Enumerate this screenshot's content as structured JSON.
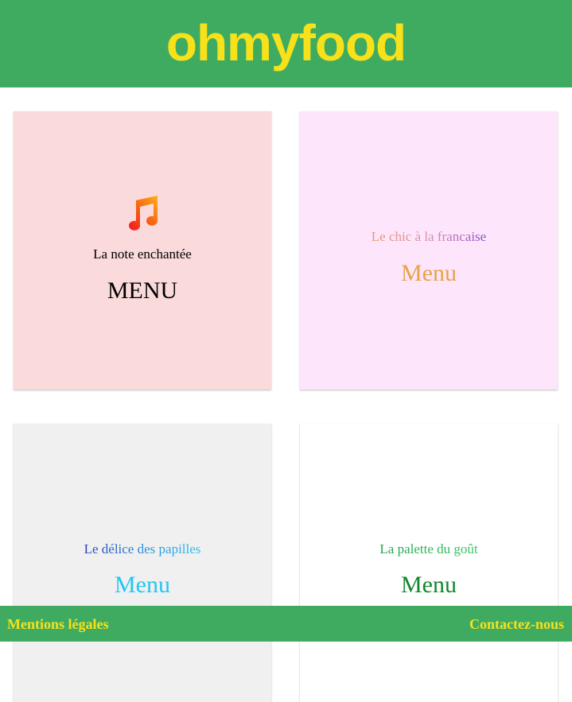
{
  "header": {
    "logo": "ohmyfood"
  },
  "restaurants": [
    {
      "name": "La note enchantée",
      "menu_label": "MENU",
      "icon": "music-note-icon",
      "background": "#fadadb",
      "text_color": "#000000"
    },
    {
      "name": "Le chic à la francaise",
      "menu_label": "Menu",
      "background": "#fde6fc",
      "menu_color": "#e8a247"
    },
    {
      "name": "Le délice des papilles",
      "menu_label": "Menu",
      "background": "#f0f0f0",
      "menu_color": "#21c6f2"
    },
    {
      "name": "La palette du goût",
      "menu_label": "Menu",
      "background": "#ffffff",
      "menu_color": "#12872e"
    }
  ],
  "footer": {
    "left_link": "Mentions légales",
    "right_link": "Contactez-nous"
  },
  "colors": {
    "brand_green": "#3fab61",
    "brand_yellow": "#f7e11a"
  }
}
